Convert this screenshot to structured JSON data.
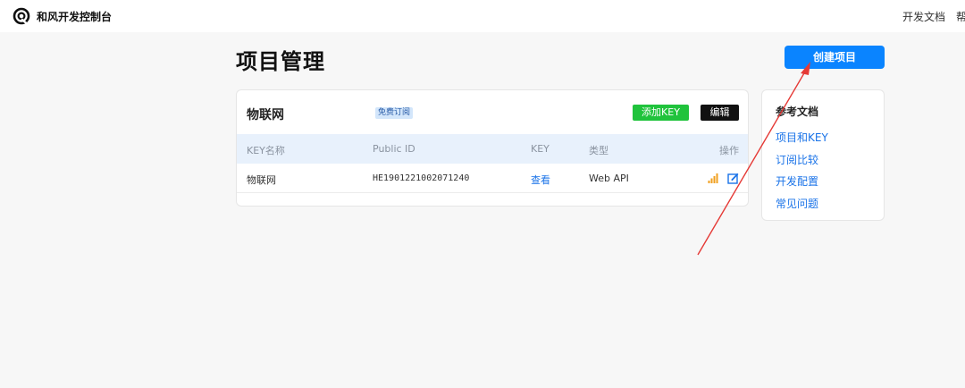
{
  "header": {
    "brand": "和风开发控制台",
    "nav": [
      "开发文档",
      "帮"
    ],
    "logo_icon": "qweather-swirl-logo"
  },
  "page": {
    "title": "项目管理",
    "create_button": "创建项目"
  },
  "project": {
    "name": "物联网",
    "plan_badge": "免费订阅",
    "add_key_button": "添加KEY",
    "edit_button": "编辑",
    "columns": [
      "KEY名称",
      "Public ID",
      "KEY",
      "类型",
      "操作"
    ],
    "rows": [
      {
        "key_name": "物联网",
        "public_id": "HE1901221002071240",
        "key_action": "查看",
        "type": "Web API",
        "actions": [
          "stats-icon",
          "edit-icon"
        ]
      }
    ]
  },
  "reference": {
    "title": "参考文档",
    "links": [
      "项目和KEY",
      "订阅比较",
      "开发配置",
      "常见问题"
    ]
  },
  "colors": {
    "primary": "#0a84ff",
    "green": "#20c33c",
    "link": "#1a73e8",
    "annotation_arrow": "#e53935"
  }
}
